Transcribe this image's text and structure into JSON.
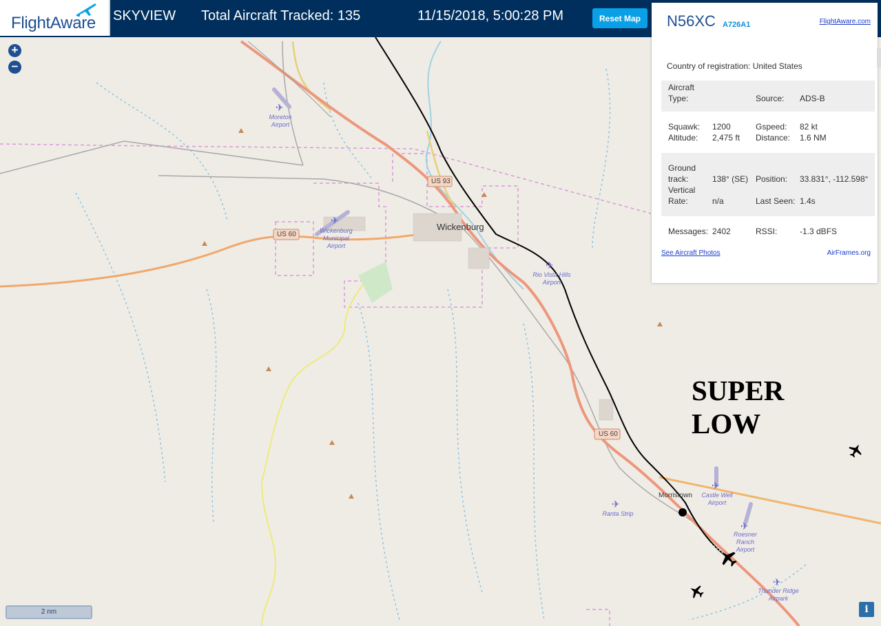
{
  "header": {
    "logo": "FlightAware",
    "app_name": "SKYVIEW",
    "total_tracked": "Total Aircraft Tracked: 135",
    "datetime": "11/15/2018, 5:00:28 PM",
    "reset_label": "Reset Map"
  },
  "map": {
    "towns": [
      "Wickenburg",
      "Morristown"
    ],
    "airports": [
      {
        "name": "Moreton Airport"
      },
      {
        "name": "Wickenburg Municipal Airport"
      },
      {
        "name": "Rio Vista Hills Airport"
      },
      {
        "name": "Castle Well Airport"
      },
      {
        "name": "Ranta Strip"
      },
      {
        "name": "Roesner Ranch Airport"
      },
      {
        "name": "Thunder Ridge Airpark"
      }
    ],
    "highway_labels": [
      "US 93",
      "US 60",
      "US 60"
    ],
    "scale_label": "2 nm",
    "info_label": "i",
    "annotation_line1": "SUPER",
    "annotation_line2": "LOW"
  },
  "aircraft_panel": {
    "callsign": "N56XC",
    "icao": "A726A1",
    "flightaware_link": "FlightAware.com",
    "country_label": "Country of registration:",
    "country_value": "United States",
    "aircraft_type_label": "Aircraft Type:",
    "aircraft_type_value": "",
    "source_label": "Source:",
    "source_value": "ADS-B",
    "squawk_label": "Squawk:",
    "squawk_value": "1200",
    "altitude_label": "Altitude:",
    "altitude_value": "2,475 ft",
    "gspeed_label": "Gspeed:",
    "gspeed_value": "82 kt",
    "distance_label": "Distance:",
    "distance_value": "1.6 NM",
    "ground_track_label": "Ground track:",
    "ground_track_value": "138° (SE)",
    "position_label": "Position:",
    "position_value": "33.831°, -112.598°",
    "vertical_rate_label": "Vertical Rate:",
    "vertical_rate_value": "n/a",
    "last_seen_label": "Last Seen:",
    "last_seen_value": "1.4s",
    "messages_label": "Messages:",
    "messages_value": "2402",
    "rssi_label": "RSSI:",
    "rssi_value": "-1.3 dBFS",
    "see_photos": "See Aircraft Photos",
    "airframes": "AirFrames.org"
  }
}
